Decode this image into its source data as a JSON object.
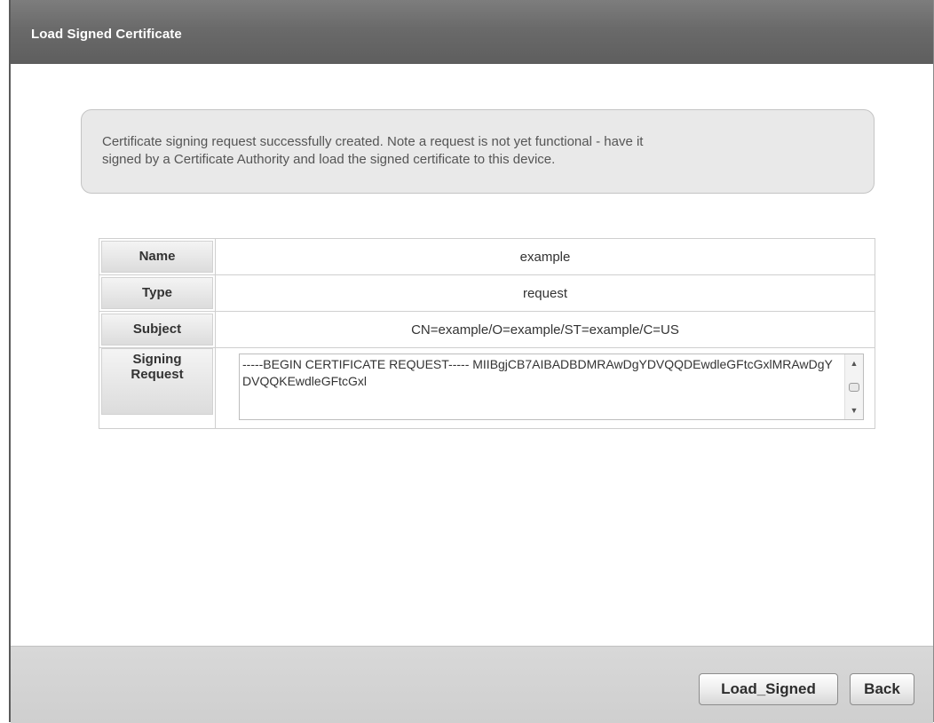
{
  "window": {
    "title": "Load Signed Certificate"
  },
  "notice": {
    "line1": "Certificate signing request successfully created. Note a request is not yet functional - have it",
    "line2": "signed by a Certificate Authority and load the signed certificate to this device."
  },
  "fields": {
    "name_label": "Name",
    "name_value": "example",
    "type_label": "Type",
    "type_value": "request",
    "subject_label": "Subject",
    "subject_value": "CN=example/O=example/ST=example/C=US",
    "signing_label_1": "Signing",
    "signing_label_2": "Request",
    "signing_value": "-----BEGIN CERTIFICATE REQUEST----- MIIBgjCB7AIBADBDMRAwDgYDVQQDEwdleGFtcGxlMRAwDgYDVQQKEwdleGFtcGxl"
  },
  "buttons": {
    "load_signed": "Load_Signed",
    "back": "Back"
  }
}
